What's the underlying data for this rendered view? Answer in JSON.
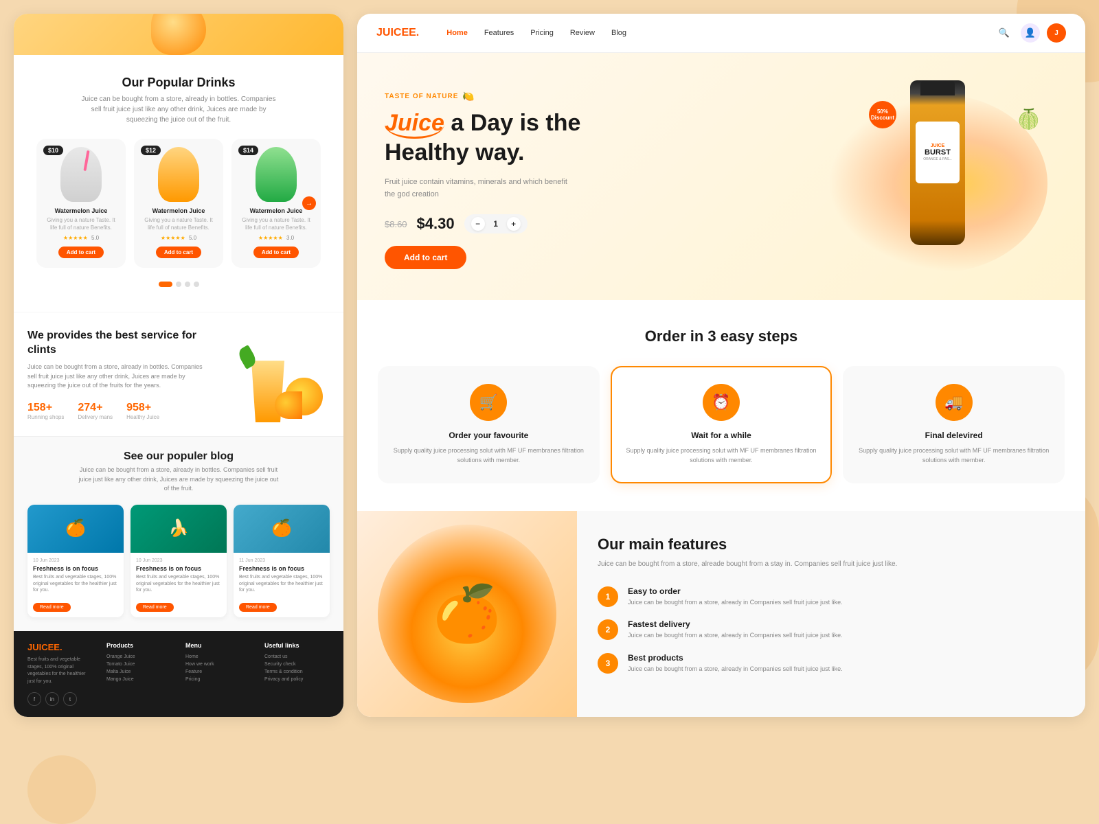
{
  "background": {
    "color": "#f5d9b0"
  },
  "left_panel": {
    "hero_section": {
      "orange_splash": "🍊"
    },
    "popular_drinks": {
      "title": "Our Popular Drinks",
      "subtitle": "Juice can be bought from a store, already in bottles. Companies sell fruit juice just like any other drink, Juices are made by squeezing the juice out of the fruit.",
      "drinks": [
        {
          "name": "Watermelon Juice",
          "desc": "Giving you a nature Taste. It life full of nature Benefits.",
          "price": "$10",
          "stars": "★★★★★",
          "rating": "5.0",
          "add_to_cart": "Add to cart",
          "type": "white"
        },
        {
          "name": "Watermelon Juice",
          "desc": "Giving you a nature Taste. It life full of nature Benefits.",
          "price": "$12",
          "stars": "★★★★★",
          "rating": "5.0",
          "add_to_cart": "Add to cart",
          "type": "orange"
        },
        {
          "name": "Watermelon Juice",
          "desc": "Giving you a nature Taste. It life full of nature Benefits.",
          "price": "$14",
          "stars": "★★★★★",
          "rating": "3.0",
          "add_to_cart": "Add to cart",
          "type": "green"
        }
      ],
      "carousel_arrow": "→"
    },
    "service_section": {
      "title": "We provides the best service for clints",
      "desc": "Juice can be bought from a store, already in bottles. Companies sell fruit juice just like any other drink, Juices are made by squeezing the juice out of the fruits for the years.",
      "stats": [
        {
          "number": "158+",
          "label": "Running shops"
        },
        {
          "number": "274+",
          "label": "Delivery mans"
        },
        {
          "number": "958+",
          "label": "Healthy Juice"
        }
      ]
    },
    "blog_section": {
      "title": "See our populer blog",
      "subtitle": "Juice can be bought from a store, already in bottles. Companies sell fruit juice just like any other drink, Juices are made by squeezing the juice out of the fruit.",
      "posts": [
        {
          "date": "10 Jun 2023",
          "title": "Freshness is on focus",
          "desc": "Best fruits and vegetable stages, 100% original vegetables for the healthier just for you.",
          "read_more": "Read more",
          "emoji": "🍊"
        },
        {
          "date": "10 Jun 2023",
          "title": "Freshness is on focus",
          "desc": "Best fruits and vegetable stages, 100% original vegetables for the healthier just for you.",
          "read_more": "Read more",
          "emoji": "🍌"
        },
        {
          "date": "11 Jun 2023",
          "title": "Freshness is on focus",
          "desc": "Best fruits and vegetable stages, 100% original vegetables for the healthier just for you.",
          "read_more": "Read more",
          "emoji": "🍊"
        }
      ]
    },
    "footer": {
      "brand": "JUICEE.",
      "brand_dot_color": "#ff6600",
      "desc": "Best fruits and vegetable stages, 100% original vegetables for the healthier just for you.",
      "social_icons": [
        "f",
        "in",
        "t"
      ],
      "columns": [
        {
          "heading": "Products",
          "links": [
            "Orange Juice",
            "Tomato Juice",
            "Malta Juice",
            "Mango Juice"
          ]
        },
        {
          "heading": "Menu",
          "links": [
            "Home",
            "How we work",
            "Feature",
            "Pricing"
          ]
        },
        {
          "heading": "Useful links",
          "links": [
            "Contact us",
            "Security check",
            "Terms & condition",
            "Privacy and policy"
          ]
        }
      ]
    }
  },
  "right_panel": {
    "nav": {
      "logo": "JUICEE.",
      "links": [
        {
          "label": "Home",
          "active": true
        },
        {
          "label": "Features"
        },
        {
          "label": "Pricing"
        },
        {
          "label": "Review"
        },
        {
          "label": "Blog"
        }
      ],
      "icons": [
        "search",
        "user",
        "avatar"
      ]
    },
    "hero": {
      "tag": "TASTE OF NATURE",
      "tag_emoji": "🍋",
      "title_prefix": "",
      "juice_word": "Juice",
      "title_suffix": "a Day is the Healthy way.",
      "desc": "Fruit juice contain vitamins, minerals and which benefit the god creation",
      "old_price": "$8.60",
      "new_price": "$4.30",
      "qty": "1",
      "add_to_cart": "Add to cart",
      "discount": "50%",
      "discount_label": "Discount",
      "bottle_brand": "JUICE",
      "bottle_name": "BURST",
      "bottle_sub": "ORANGE & PAS..."
    },
    "steps": {
      "title": "Order in 3 easy steps",
      "items": [
        {
          "icon": "🛒",
          "title": "Order your favourite",
          "desc": "Supply quality juice processing solut with MF UF membranes filtration solutions with member.",
          "highlighted": false
        },
        {
          "icon": "⏰",
          "title": "Wait for a while",
          "desc": "Supply quality juice processing solut with MF UF membranes filtration solutions with member.",
          "highlighted": true
        },
        {
          "icon": "🚚",
          "title": "Final delevired",
          "desc": "Supply quality juice processing solut with MF UF membranes filtration solutions with member.",
          "highlighted": false
        }
      ]
    },
    "features": {
      "title": "Our main features",
      "desc": "Juice can be bought from a store, alreade bought from a stay in. Companies sell fruit juice just like.",
      "items": [
        {
          "num": "1",
          "title": "Easy to order",
          "desc": "Juice can be bought from a store, already in Companies sell fruit juice just like."
        },
        {
          "num": "2",
          "title": "Fastest delivery",
          "desc": "Juice can be bought from a store, already in Companies sell fruit juice just like."
        },
        {
          "num": "3",
          "title": "Best products",
          "desc": "Juice can be bought from a store, already in Companies sell fruit juice just like."
        }
      ]
    }
  }
}
